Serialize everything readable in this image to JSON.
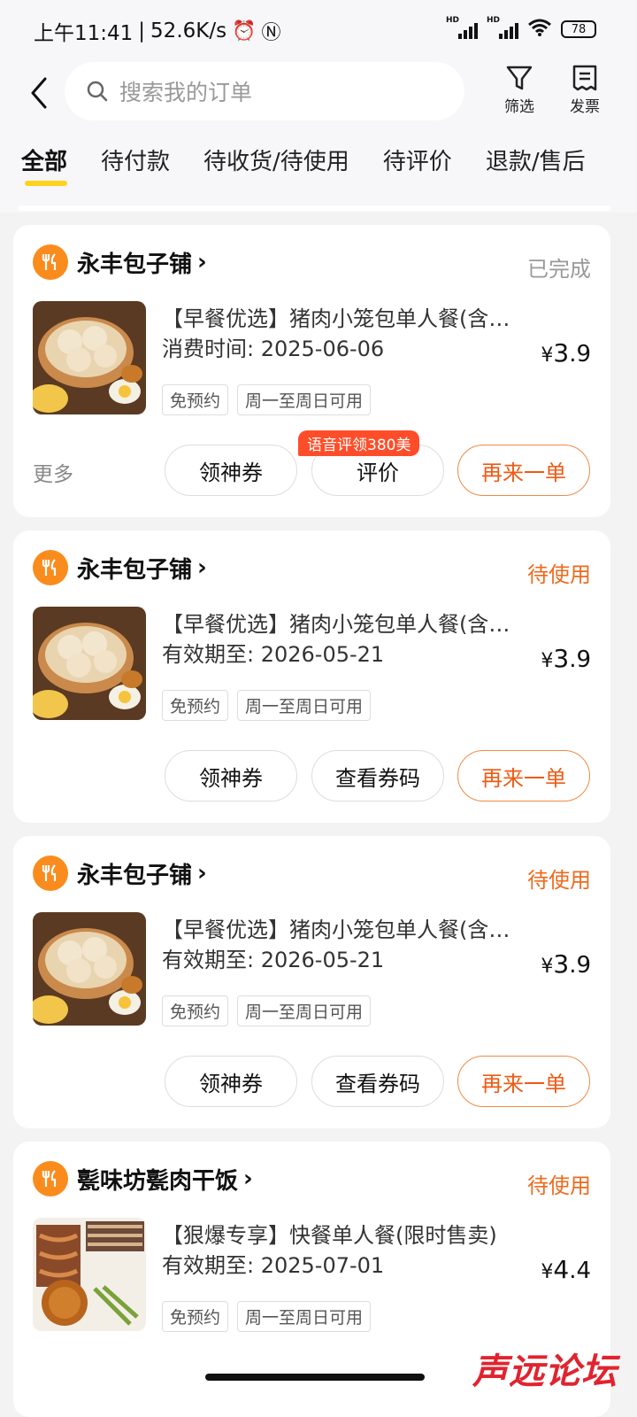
{
  "status_bar": {
    "time": "上午11:41",
    "net_speed": "52.6K/s",
    "hd": "HD",
    "battery": "78"
  },
  "search": {
    "placeholder": "搜索我的订单"
  },
  "toolbar": {
    "filter_label": "筛选",
    "invoice_label": "发票"
  },
  "tabs": [
    {
      "label": "全部",
      "active": true
    },
    {
      "label": "待付款"
    },
    {
      "label": "待收货/待使用"
    },
    {
      "label": "待评价"
    },
    {
      "label": "退款/售后"
    }
  ],
  "orders": [
    {
      "shop": "永丰包子铺",
      "status": "已完成",
      "title": "【早餐优选】猪肉小笼包单人餐(含…",
      "subtitle": "消费时间: 2025-06-06",
      "price_symbol": "¥",
      "price_int": "3",
      "price_dec": ".9",
      "tags": [
        "免预约",
        "周一至周日可用"
      ],
      "more": "更多",
      "promo": "语音评领380美",
      "buttons": [
        "领神券",
        "评价",
        "再来一单"
      ]
    },
    {
      "shop": "永丰包子铺",
      "status": "待使用",
      "title": "【早餐优选】猪肉小笼包单人餐(含…",
      "subtitle": "有效期至: 2026-05-21",
      "price_symbol": "¥",
      "price_int": "3",
      "price_dec": ".9",
      "tags": [
        "免预约",
        "周一至周日可用"
      ],
      "buttons": [
        "领神券",
        "查看券码",
        "再来一单"
      ]
    },
    {
      "shop": "永丰包子铺",
      "status": "待使用",
      "title": "【早餐优选】猪肉小笼包单人餐(含…",
      "subtitle": "有效期至: 2026-05-21",
      "price_symbol": "¥",
      "price_int": "3",
      "price_dec": ".9",
      "tags": [
        "免预约",
        "周一至周日可用"
      ],
      "buttons": [
        "领神券",
        "查看券码",
        "再来一单"
      ]
    },
    {
      "shop": "甏味坊甏肉干饭",
      "status": "待使用",
      "title": "【狠爆专享】快餐单人餐(限时售卖)",
      "subtitle": "有效期至: 2025-07-01",
      "price_symbol": "¥",
      "price_int": "4",
      "price_dec": ".4",
      "tags": [
        "免预约",
        "周一至周日可用"
      ]
    }
  ],
  "watermark": "声远论坛",
  "colors": {
    "accent_orange": "#ef5a14",
    "status_pending": "#ef6a1e",
    "tab_underline": "#ffd21f",
    "shop_icon_bg": "#fa8c1d",
    "promo_bg": "#ff4d29"
  }
}
